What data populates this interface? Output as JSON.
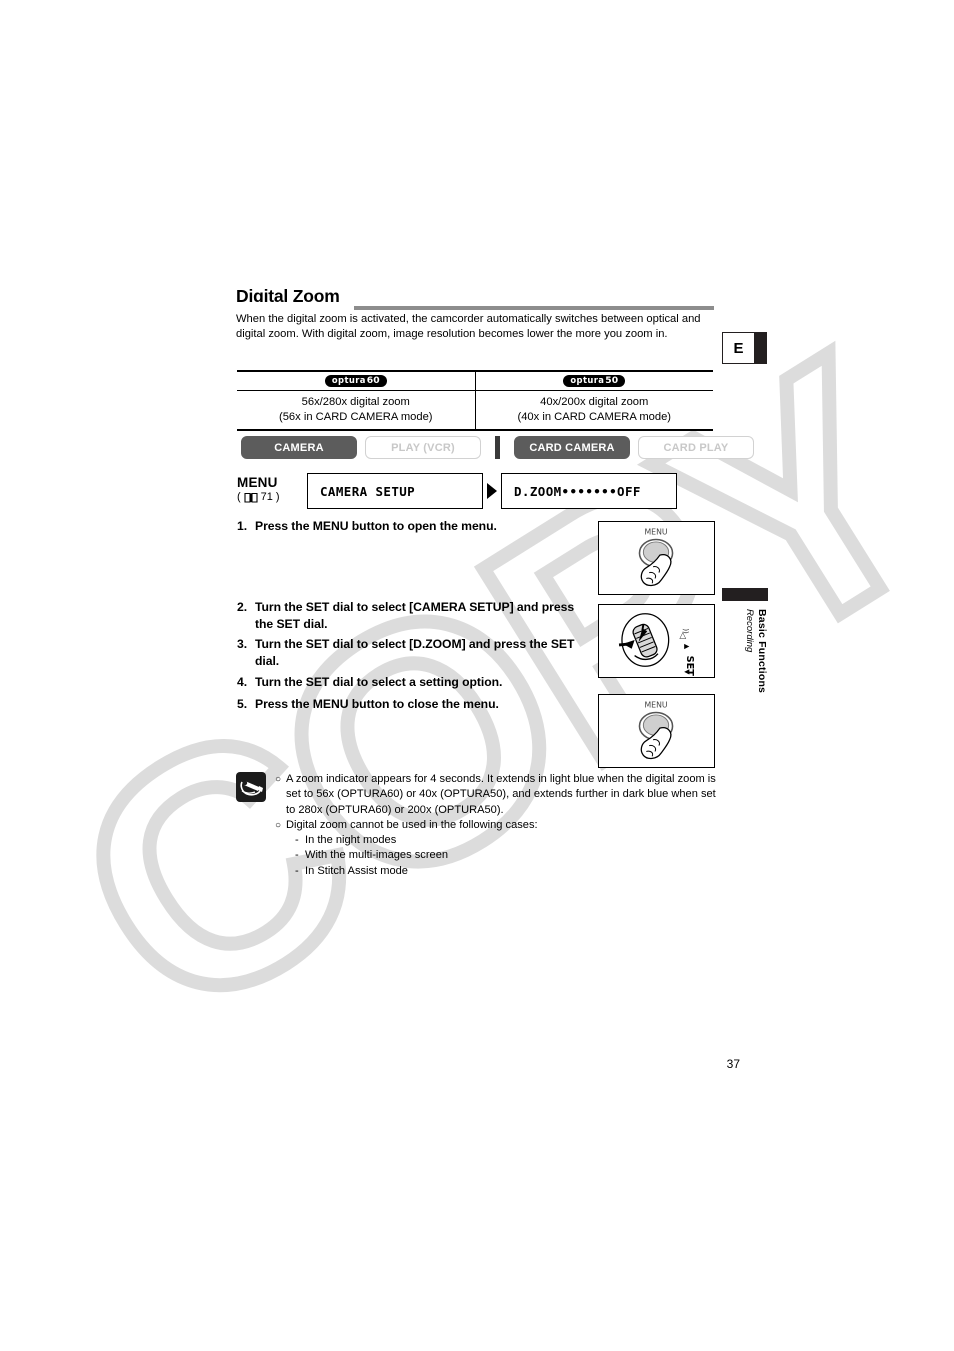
{
  "document": {
    "title": "Digital Zoom",
    "page_number": "37",
    "language_tab": "E",
    "watermark": "COPY",
    "chapter": "Basic Functions",
    "section": "Recording"
  },
  "intro": {
    "paragraph": "When the digital zoom is activated, the camcorder automatically switches between optical and digital zoom. With digital zoom, image resolution becomes lower the more you zoom in."
  },
  "spec_table": {
    "headers": [
      {
        "brand": "optura",
        "model": "60"
      },
      {
        "brand": "optura",
        "model": "50"
      }
    ],
    "rows": [
      {
        "left_line1": "56x/280x digital zoom",
        "left_line2": "(56x in CARD CAMERA mode)",
        "right_line1": "40x/200x digital zoom",
        "right_line2": "(40x in CARD CAMERA mode)"
      }
    ]
  },
  "modes": [
    {
      "label": "CAMERA",
      "active": true
    },
    {
      "label": "PLAY (VCR)",
      "active": false
    },
    {
      "label": "CARD CAMERA",
      "active": true
    },
    {
      "label": "CARD PLAY",
      "active": false
    }
  ],
  "menu": {
    "label": "MENU",
    "reference_open": "(",
    "reference_page": "71",
    "reference_close": ")",
    "book_icon": "book-icon",
    "screens": [
      {
        "text": "CAMERA SETUP"
      },
      {
        "text": "D.ZOOM•••••••OFF"
      }
    ]
  },
  "steps": [
    {
      "num": "1.",
      "text": "Press the MENU button to open the menu."
    },
    {
      "num": "2.",
      "text": "Turn the SET dial to select [CAMERA SETUP] and press the SET dial."
    },
    {
      "num": "3.",
      "text": "Turn the SET dial to select [D.ZOOM] and press the SET dial."
    },
    {
      "num": "4.",
      "text": "Turn the SET dial to select a setting option."
    },
    {
      "num": "5.",
      "text": "Press the MENU button to close the menu."
    }
  ],
  "illustrations": [
    {
      "name": "menu-button-press",
      "caption": "MENU"
    },
    {
      "name": "set-dial-turn",
      "caption": "SET"
    },
    {
      "name": "menu-button-press",
      "caption": "MENU"
    }
  ],
  "notes": {
    "icon": "notes-pen-icon",
    "items": [
      "A zoom indicator appears for 4 seconds. It extends in light blue when the digital zoom is set to 56x (OPTURA60) or 40x (OPTURA50), and extends further in dark blue when set to 280x (OPTURA60) or 200x (OPTURA50).",
      "Digital zoom cannot be used in the following cases:"
    ],
    "sub_items": [
      "In the night modes",
      "With the multi-images screen",
      "In Stitch Assist mode"
    ]
  },
  "colors": {
    "active_button": "#5c5c5c",
    "inactive_button_text": "#c8c8c8",
    "rule": "#8d8d8d",
    "watermark": "#dcdcdc",
    "tab_black": "#231f20"
  }
}
